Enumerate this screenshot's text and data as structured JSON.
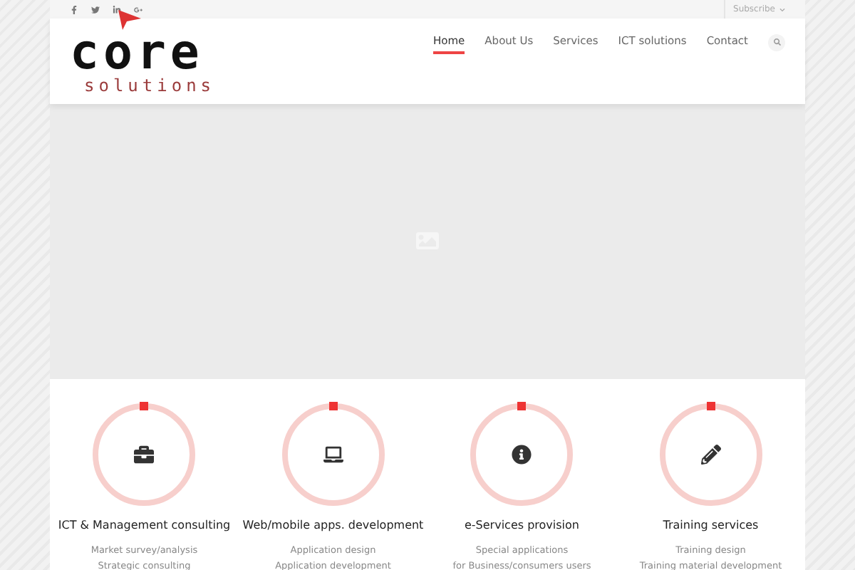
{
  "topbar": {
    "subscribe": "Subscribe"
  },
  "logo": {
    "text": "core",
    "tagline": "solutions"
  },
  "nav": [
    {
      "label": "Home",
      "selected": true
    },
    {
      "label": "About Us",
      "selected": false
    },
    {
      "label": "Services",
      "selected": false
    },
    {
      "label": "ICT solutions",
      "selected": false
    },
    {
      "label": "Contact",
      "selected": false
    }
  ],
  "services": [
    {
      "title": "ICT & Management consulting",
      "lines": [
        "Market survey/analysis",
        "Strategic consulting"
      ]
    },
    {
      "title": "Web/mobile apps. development",
      "lines": [
        "Application design",
        "Application development"
      ]
    },
    {
      "title": "e-Services provision",
      "lines": [
        "Special applications",
        "for Business/consumers users"
      ]
    },
    {
      "title": "Training services",
      "lines": [
        "Training design",
        "Training material development"
      ]
    }
  ]
}
